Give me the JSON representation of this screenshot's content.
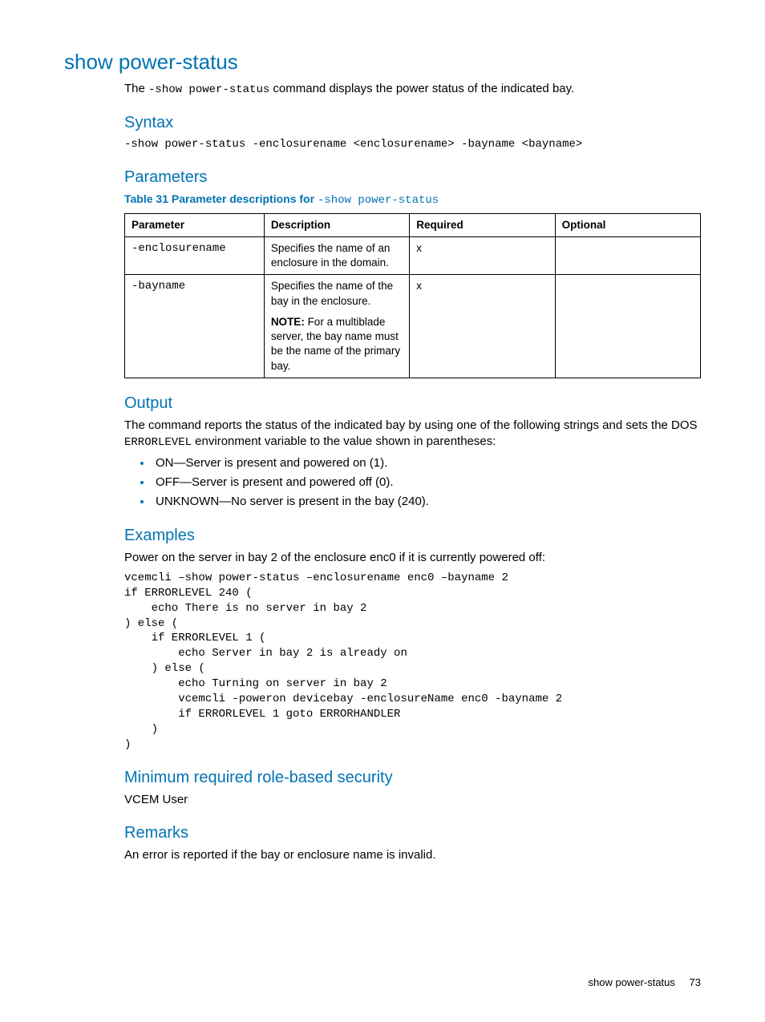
{
  "title": "show power-status",
  "intro_pre": "The ",
  "intro_cmd": "-show power-status",
  "intro_post": " command displays the power status of the indicated bay.",
  "syntax": {
    "heading": "Syntax",
    "line": "-show power-status -enclosurename <enclosurename> -bayname <bayname>"
  },
  "parameters": {
    "heading": "Parameters",
    "caption_pre": "Table 31 Parameter descriptions for ",
    "caption_cmd": "-show power-status",
    "headers": {
      "parameter": "Parameter",
      "description": "Description",
      "required": "Required",
      "optional": "Optional"
    },
    "rows": [
      {
        "param": "-enclosurename",
        "desc": "Specifies the name of an enclosure in the domain.",
        "note_label": "",
        "note_text": "",
        "required": "x",
        "optional": ""
      },
      {
        "param": "-bayname",
        "desc": "Specifies the name of the bay in the enclosure.",
        "note_label": "NOTE:",
        "note_text": "   For a multiblade server, the bay name must be the name of the primary bay.",
        "required": "x",
        "optional": ""
      }
    ]
  },
  "output": {
    "heading": "Output",
    "p1_pre": "The command reports the status of the indicated bay by using one of the following strings and sets the DOS ",
    "p1_code": "ERRORLEVEL",
    "p1_post": " environment variable to the value shown in parentheses:",
    "bullets": [
      "ON—Server is present and powered on (1).",
      "OFF—Server is present and powered off (0).",
      "UNKNOWN—No server is present in the bay (240)."
    ]
  },
  "examples": {
    "heading": "Examples",
    "intro": "Power on the server in bay 2 of the enclosure enc0 if it is currently powered off:",
    "code": "vcemcli –show power-status –enclosurename enc0 –bayname 2\nif ERRORLEVEL 240 (\n    echo There is no server in bay 2\n) else (\n    if ERRORLEVEL 1 (\n        echo Server in bay 2 is already on\n    ) else (\n        echo Turning on server in bay 2\n        vcemcli -poweron devicebay -enclosureName enc0 -bayname 2\n        if ERRORLEVEL 1 goto ERRORHANDLER\n    )\n)"
  },
  "security": {
    "heading": "Minimum required role-based security",
    "text": "VCEM User"
  },
  "remarks": {
    "heading": "Remarks",
    "text": "An error is reported if the bay or enclosure name is invalid."
  },
  "footer": {
    "title": "show power-status",
    "page": "73"
  }
}
